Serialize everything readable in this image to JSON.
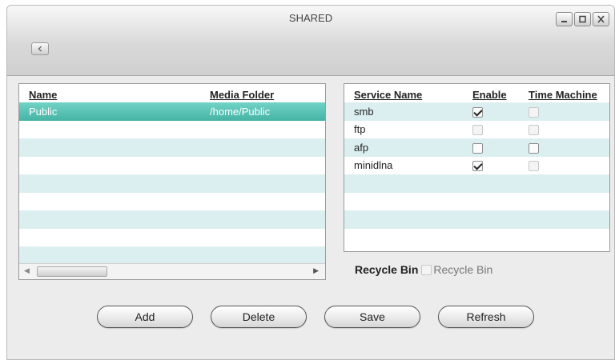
{
  "window": {
    "title": "SHARED"
  },
  "shares": {
    "columns": [
      "Name",
      "Media Folder"
    ],
    "rows": [
      {
        "name": "Public",
        "media_folder": "/home/Public",
        "selected": true
      }
    ],
    "empty_rows": 8
  },
  "services": {
    "columns": [
      "Service Name",
      "Enable",
      "Time Machine"
    ],
    "rows": [
      {
        "name": "smb",
        "enable": true,
        "enable_disabled": false,
        "time_machine": false,
        "tm_disabled": true
      },
      {
        "name": "ftp",
        "enable": false,
        "enable_disabled": true,
        "time_machine": false,
        "tm_disabled": true
      },
      {
        "name": "afp",
        "enable": false,
        "enable_disabled": false,
        "time_machine": false,
        "tm_disabled": false
      },
      {
        "name": "minidlna",
        "enable": true,
        "enable_disabled": false,
        "time_machine": false,
        "tm_disabled": true
      }
    ],
    "empty_rows": 4
  },
  "recycle_bin": {
    "label": "Recycle Bin",
    "checkbox_label": "Recycle Bin",
    "checked": false
  },
  "buttons": {
    "add": "Add",
    "delete": "Delete",
    "save": "Save",
    "refresh": "Refresh"
  },
  "icons": {
    "back": "chevron-left-icon",
    "minimize": "minimize-icon",
    "maximize": "maximize-icon",
    "close": "close-icon"
  },
  "colors": {
    "selected_row": "#4fbdb0",
    "alt_row": "#dceff0"
  }
}
